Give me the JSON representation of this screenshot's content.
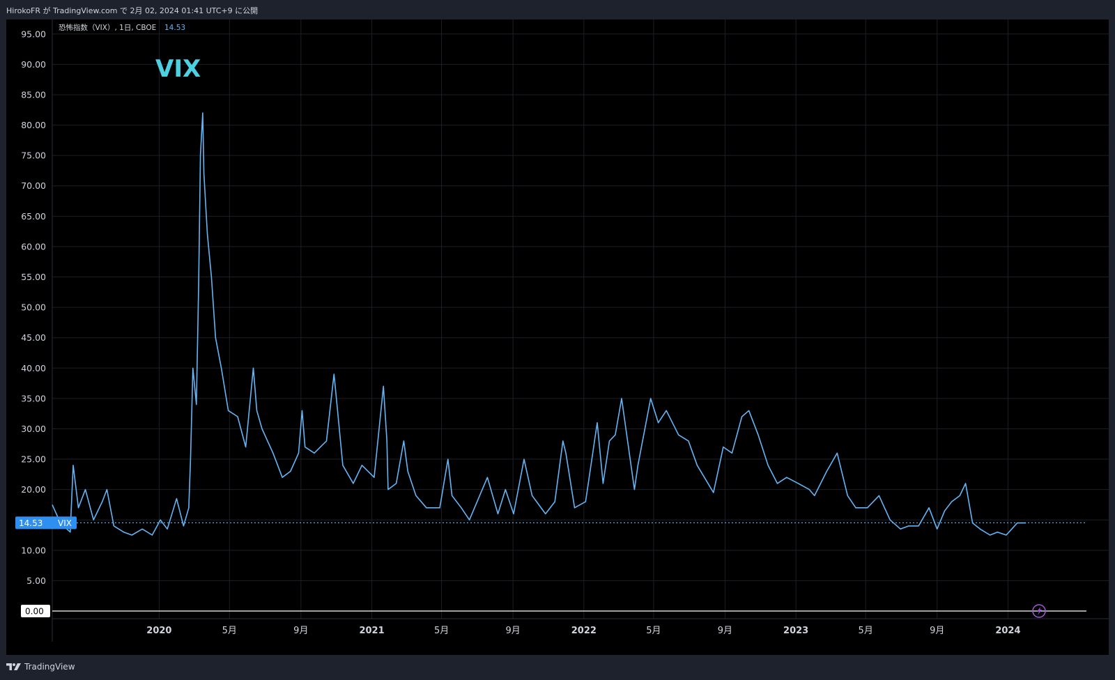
{
  "header": {
    "caption": "HirokoFR が TradingView.com で 2月 02, 2024 01:41 UTC+9 に公開"
  },
  "legend": {
    "symbol_text": "恐怖指数（VIX）, 1日, CBOE",
    "last_value": "14.53"
  },
  "annotation": {
    "text": "VIX"
  },
  "price_tag": {
    "value": "14.53",
    "symbol": "VIX"
  },
  "zero_tag": {
    "value": "0.00"
  },
  "footer": {
    "brand": "TradingView"
  },
  "colors": {
    "line": "#64b5f6",
    "annotation": "#4dd0e1",
    "grid": "#1c1f26",
    "tag_bg": "#2f8ff0",
    "alert": "#a45ae0"
  },
  "icons": {
    "alert": "lightning-icon",
    "brand": "tradingview-logo-icon"
  },
  "chart_data": {
    "type": "line",
    "title": "",
    "xlabel": "",
    "ylabel": "",
    "ylim": [
      0,
      97.5
    ],
    "y_ticks": [
      "95.00",
      "90.00",
      "85.00",
      "80.00",
      "75.00",
      "70.00",
      "65.00",
      "60.00",
      "55.00",
      "50.00",
      "45.00",
      "40.00",
      "35.00",
      "30.00",
      "25.00",
      "20.00",
      "15.00",
      "10.00",
      "5.00",
      "0.00"
    ],
    "x_ticks": [
      "2020",
      "5月",
      "9月",
      "2021",
      "5月",
      "9月",
      "2022",
      "5月",
      "9月",
      "2023",
      "5月",
      "9月",
      "2024"
    ],
    "x_ticks_bold": [
      "2020",
      "2021",
      "2022",
      "2023",
      "2024"
    ],
    "x_range": [
      "2019-07-01",
      "2024-05-15"
    ],
    "series": [
      {
        "x": [
          "2019-07-01",
          "2019-07-15",
          "2019-08-01",
          "2019-08-06",
          "2019-08-15",
          "2019-08-27",
          "2019-09-10",
          "2019-09-25",
          "2019-10-03",
          "2019-10-15",
          "2019-11-01",
          "2019-11-15",
          "2019-12-03",
          "2019-12-20",
          "2020-01-03",
          "2020-01-15",
          "2020-01-31",
          "2020-02-12",
          "2020-02-21",
          "2020-02-24",
          "2020-02-28",
          "2020-03-05",
          "2020-03-09",
          "2020-03-12",
          "2020-03-16",
          "2020-03-18",
          "2020-03-24",
          "2020-03-31",
          "2020-04-07",
          "2020-04-17",
          "2020-04-29",
          "2020-05-15",
          "2020-05-29",
          "2020-06-11",
          "2020-06-17",
          "2020-06-26",
          "2020-07-15",
          "2020-07-31",
          "2020-08-14",
          "2020-08-28",
          "2020-09-03",
          "2020-09-08",
          "2020-09-24",
          "2020-10-15",
          "2020-10-28",
          "2020-11-03",
          "2020-11-12",
          "2020-11-30",
          "2020-12-15",
          "2021-01-05",
          "2021-01-21",
          "2021-01-27",
          "2021-01-29",
          "2021-02-12",
          "2021-02-25",
          "2021-03-04",
          "2021-03-18",
          "2021-04-05",
          "2021-04-28",
          "2021-05-12",
          "2021-05-19",
          "2021-06-04",
          "2021-06-18",
          "2021-07-19",
          "2021-08-06",
          "2021-08-19",
          "2021-09-02",
          "2021-09-20",
          "2021-10-04",
          "2021-10-27",
          "2021-11-12",
          "2021-11-26",
          "2021-12-01",
          "2021-12-16",
          "2022-01-04",
          "2022-01-24",
          "2022-02-03",
          "2022-02-14",
          "2022-02-24",
          "2022-03-07",
          "2022-03-29",
          "2022-04-04",
          "2022-04-26",
          "2022-05-09",
          "2022-05-23",
          "2022-06-13",
          "2022-06-30",
          "2022-07-15",
          "2022-08-12",
          "2022-08-29",
          "2022-09-13",
          "2022-09-30",
          "2022-10-12",
          "2022-10-28",
          "2022-11-14",
          "2022-11-30",
          "2022-12-16",
          "2023-01-05",
          "2023-01-24",
          "2023-02-02",
          "2023-02-23",
          "2023-03-13",
          "2023-03-31",
          "2023-04-14",
          "2023-05-04",
          "2023-05-24",
          "2023-06-12",
          "2023-06-30",
          "2023-07-14",
          "2023-07-31",
          "2023-08-18",
          "2023-09-01",
          "2023-09-14",
          "2023-09-26",
          "2023-10-10",
          "2023-10-20",
          "2023-11-01",
          "2023-11-14",
          "2023-12-01",
          "2023-12-14",
          "2023-12-29",
          "2024-01-17",
          "2024-01-31",
          "2024-02-01"
        ],
        "y": [
          17.5,
          14.5,
          13,
          24,
          17,
          20,
          15,
          18,
          20,
          14,
          13,
          12.5,
          13.5,
          12.5,
          15,
          13.5,
          18.5,
          14,
          17,
          25,
          40,
          34,
          54,
          75,
          82,
          72,
          62,
          55,
          45,
          40,
          33,
          32,
          27,
          40,
          33,
          30,
          26,
          22,
          23,
          26,
          33,
          27,
          26,
          28,
          39,
          33,
          24,
          21,
          24,
          22,
          37,
          28,
          20,
          21,
          28,
          23,
          19,
          17,
          17,
          25,
          19,
          17,
          15,
          22,
          16,
          20,
          16,
          25,
          19,
          16,
          18,
          28,
          26,
          17,
          18,
          31,
          21,
          28,
          29,
          35,
          20,
          24,
          35,
          31,
          33,
          29,
          28,
          24,
          19.5,
          27,
          26,
          32,
          33,
          29,
          24,
          21,
          22,
          21,
          20,
          19,
          23,
          26,
          19,
          17,
          17,
          19,
          15,
          13.5,
          14,
          14,
          17,
          13.5,
          16.5,
          18,
          19,
          21,
          14.5,
          13.5,
          12.5,
          13,
          12.5,
          14.5,
          14.5,
          14.53
        ]
      }
    ]
  }
}
